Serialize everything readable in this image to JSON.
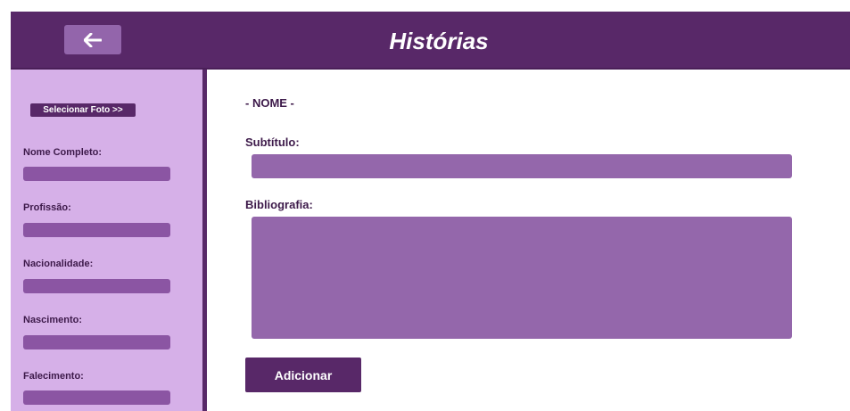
{
  "header": {
    "title": "Histórias",
    "back_icon": "arrow-left-icon"
  },
  "sidebar": {
    "select_photo_label": "Selecionar Foto >>",
    "fields": [
      {
        "label": "Nome Completo:",
        "value": ""
      },
      {
        "label": "Profissão:",
        "value": ""
      },
      {
        "label": "Nacionalidade:",
        "value": ""
      },
      {
        "label": "Nascimento:",
        "value": ""
      },
      {
        "label": "Falecimento:",
        "value": ""
      }
    ]
  },
  "main": {
    "name_heading": "- NOME -",
    "subtitle_label": "Subtítulo:",
    "subtitle_value": "",
    "bio_label": "Bibliografia:",
    "bio_value": "",
    "add_label": "Adicionar"
  },
  "colors": {
    "header_bg": "#582868",
    "sidebar_bg": "#d6b0e8",
    "input_bg": "#9467ab",
    "sidebar_input_bg": "#8b55a3",
    "button_bg": "#582868",
    "back_button_bg": "#9365ab"
  }
}
